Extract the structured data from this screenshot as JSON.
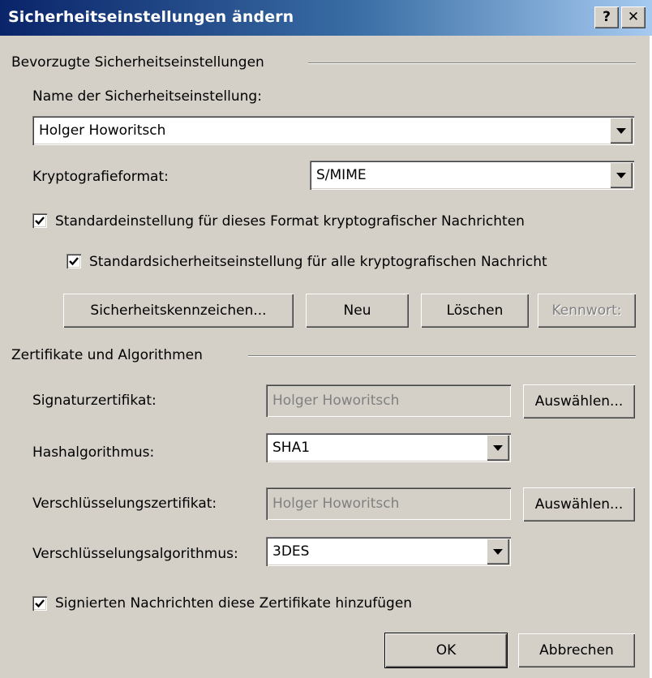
{
  "window": {
    "title": "Sicherheitseinstellungen ändern",
    "help_glyph": "?",
    "close_glyph": "✕"
  },
  "preferred": {
    "group_title": "Bevorzugte Sicherheitseinstellungen",
    "name_label": "Name der Sicherheitseinstellung:",
    "name_value": "Holger Howoritsch",
    "format_label": "Kryptografieformat:",
    "format_value": "S/MIME",
    "default_format_check": {
      "label": "Standardeinstellung für dieses Format kryptografischer Nachrichten",
      "checked": true
    },
    "default_all_check": {
      "label": "Standardsicherheitseinstellung für alle kryptografischen Nachricht",
      "checked": true
    },
    "buttons": {
      "labels": "Sicherheitskennzeichen...",
      "new": "Neu",
      "delete": "Löschen",
      "password": "Kennwort:"
    }
  },
  "certs": {
    "group_title": "Zertifikate und Algorithmen",
    "sign_cert_label": "Signaturzertifikat:",
    "sign_cert_value": "Holger Howoritsch",
    "choose_label": "Auswählen...",
    "hash_label": "Hashalgorithmus:",
    "hash_value": "SHA1",
    "enc_cert_label": "Verschlüsselungszertifikat:",
    "enc_cert_value": "Holger Howoritsch",
    "enc_alg_label": "Verschlüsselungsalgorithmus:",
    "enc_alg_value": "3DES"
  },
  "attach_check": {
    "label": "Signierten Nachrichten diese Zertifikate hinzufügen",
    "checked": true
  },
  "footer": {
    "ok": "OK",
    "cancel": "Abbrechen"
  }
}
